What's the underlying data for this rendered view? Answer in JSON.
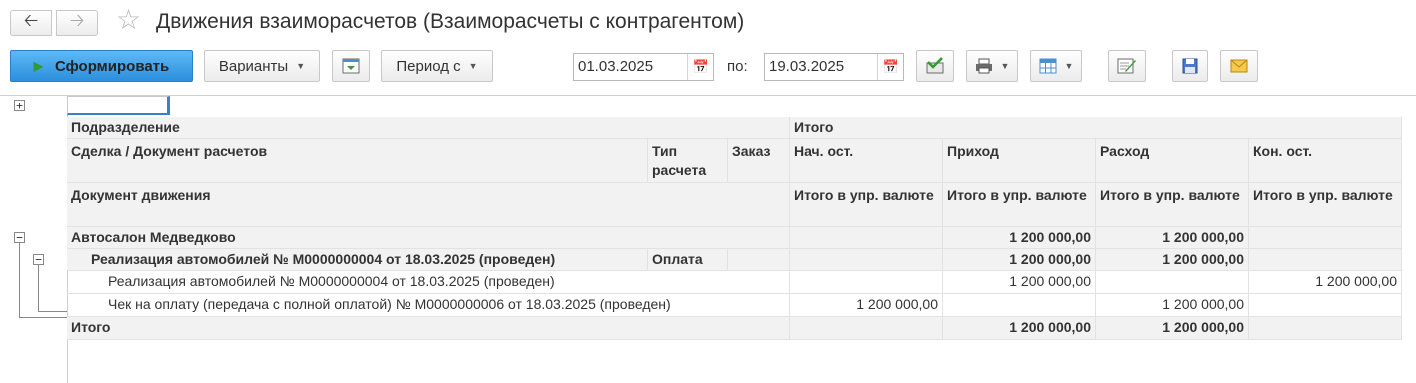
{
  "window": {
    "title": "Движения взаиморасчетов (Взаиморасчеты с контрагентом)"
  },
  "toolbar": {
    "generate_label": "Сформировать",
    "variants_label": "Варианты",
    "period_label": "Период с",
    "date_from": "01.03.2025",
    "to_label": "по:",
    "date_to": "19.03.2025"
  },
  "table": {
    "headers": {
      "division": "Подразделение",
      "total": "Итого",
      "deal_doc": "Сделка / Документ расчетов",
      "calc_type": "Тип расчета",
      "order": "Заказ",
      "opening": "Нач. ост.",
      "income": "Приход",
      "expense": "Расход",
      "closing": "Кон. ост.",
      "movement_doc": "Документ движения",
      "currency_sub": "Итого в упр. валюте"
    },
    "rows": [
      {
        "label": "Автосалон Медведково",
        "calc_type": "",
        "order": "",
        "opening": "",
        "income": "1 200 000,00",
        "expense": "1 200 000,00",
        "closing": ""
      },
      {
        "label": "Реализация автомобилей № М0000000004 от 18.03.2025 (проведен)",
        "calc_type": "Оплата",
        "order": "",
        "opening": "",
        "income": "1 200 000,00",
        "expense": "1 200 000,00",
        "closing": ""
      },
      {
        "label": "Реализация автомобилей № М0000000004 от 18.03.2025 (проведен)",
        "calc_type": "",
        "order": "",
        "opening": "",
        "income": "1 200 000,00",
        "expense": "",
        "closing": "1 200 000,00"
      },
      {
        "label": "Чек на оплату (передача с полной оплатой) № М0000000006 от 18.03.2025 (проведен)",
        "calc_type": "",
        "order": "",
        "opening": "1 200 000,00",
        "income": "",
        "expense": "1 200 000,00",
        "closing": ""
      }
    ],
    "total": {
      "label": "Итого",
      "opening": "",
      "income": "1 200 000,00",
      "expense": "1 200 000,00",
      "closing": ""
    }
  }
}
